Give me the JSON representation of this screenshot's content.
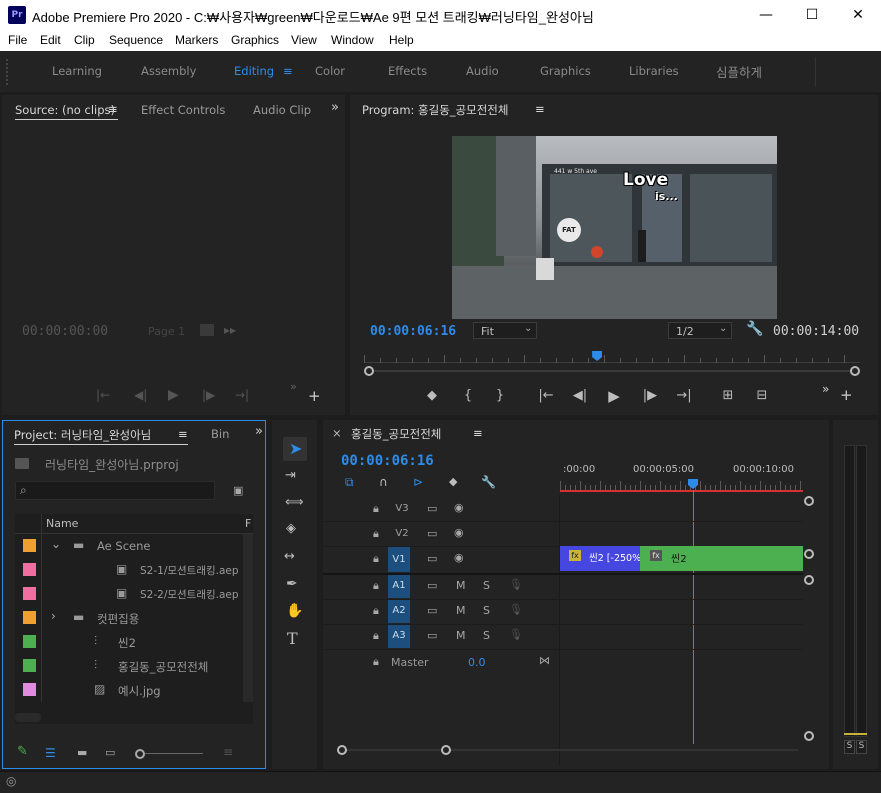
{
  "window": {
    "app_icon": "Pr",
    "title": "Adobe Premiere Pro 2020 - C:₩사용자₩green₩다운로드₩Ae 9편 모션 트래킹₩러닝타임_완성아님",
    "minimize": "—",
    "maximize": "☐",
    "close": "✕"
  },
  "menu": [
    "File",
    "Edit",
    "Clip",
    "Sequence",
    "Markers",
    "Graphics",
    "View",
    "Window",
    "Help"
  ],
  "workspaces": {
    "items": [
      "Learning",
      "Assembly",
      "Editing",
      "Color",
      "Effects",
      "Audio",
      "Graphics",
      "Libraries",
      "심플하게"
    ],
    "active": "Editing",
    "active_menu_icon": "≡"
  },
  "source": {
    "tabs": [
      "Source: (no clips)",
      "Effect Controls",
      "Audio Clip"
    ],
    "tab_menu_icon": "≡",
    "overflow": "»",
    "timecode": "00:00:00:00",
    "page": "Page 1"
  },
  "program": {
    "title": "Program: 홍길동_공모전전체",
    "tab_menu_icon": "≡",
    "video_text_1": "Love",
    "video_text_2": "is...",
    "video_sign": "441 w 5th ave",
    "video_logo": "FAT",
    "current_timecode": "00:00:06:16",
    "fit": "Fit",
    "resolution": "1/2",
    "duration": "00:00:14:00",
    "playhead_fraction": 0.47,
    "overflow": "»",
    "add": "+"
  },
  "project": {
    "title": "Project: 러닝타임_완성아님",
    "tab_menu_icon": "≡",
    "bin_tab": "Bin",
    "overflow": "»",
    "file": "러닝타임_완성아님.prproj",
    "search_placeholder": "",
    "column_name": "Name",
    "column_f": "F",
    "items": [
      {
        "name": "Ae Scene",
        "color": "#f0a030",
        "kind": "folder",
        "indent": 0,
        "chevron": "⌄"
      },
      {
        "name": "S2-1/모션트래킹.aep",
        "color": "#f06fa0",
        "kind": "aep",
        "indent": 2,
        "chevron": ""
      },
      {
        "name": "S2-2/모션트래킹.aep",
        "color": "#f06fa0",
        "kind": "aep",
        "indent": 2,
        "chevron": ""
      },
      {
        "name": "컷편집용",
        "color": "#f0a030",
        "kind": "folder",
        "indent": 0,
        "chevron": "›"
      },
      {
        "name": "씬2",
        "color": "#4caf50",
        "kind": "sequence",
        "indent": 1,
        "chevron": ""
      },
      {
        "name": "홍길동_공모전전체",
        "color": "#4caf50",
        "kind": "sequence",
        "indent": 1,
        "chevron": ""
      },
      {
        "name": "예시.jpg",
        "color": "#e08be0",
        "kind": "image",
        "indent": 1,
        "chevron": ""
      }
    ]
  },
  "timeline": {
    "close": "×",
    "title": "홍길동_공모전전체",
    "tab_menu_icon": "≡",
    "timecode": "00:00:06:16",
    "ruler": [
      ":00:00",
      "00:00:05:00",
      "00:00:10:00"
    ],
    "tracks_video": [
      "V3",
      "V2",
      "V1"
    ],
    "tracks_audio": [
      "A1",
      "A2",
      "A3"
    ],
    "mute": "M",
    "solo": "S",
    "master_label": "Master",
    "master_value": "0.0",
    "clip1": "씬2 [-250%]",
    "clip2": "씬2",
    "fx": "fx",
    "meter_labels": [
      "S",
      "S"
    ]
  },
  "colors": {
    "accent": "#2d8ceb",
    "clip_blue": "#4646e0",
    "clip_green": "#4caf50",
    "track_on": "#1c4f7d"
  }
}
